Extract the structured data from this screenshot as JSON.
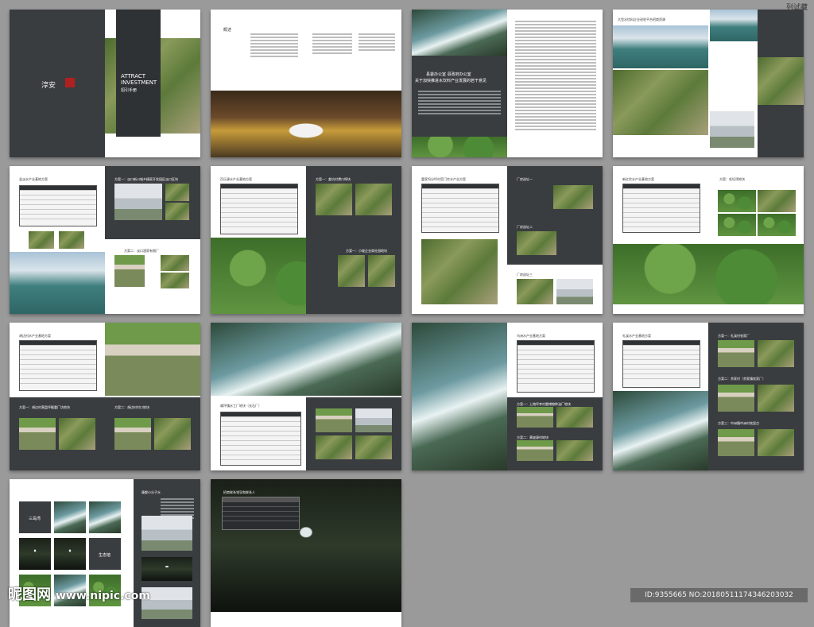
{
  "tag": "列试藏",
  "cover": {
    "seal": "淳安",
    "title_line1": "ATTRACT",
    "title_line2": "INVESTMENT",
    "subtitle": "招引手册"
  },
  "spread2": {
    "heading": "概述"
  },
  "spread3": {
    "title_line1": "县委办公室  县政府办公室",
    "title_line2": "关于加快推进水饮料产业发展的若干意见"
  },
  "spread4": {
    "heading": "大型水饮料企业进驻平台招商资源"
  },
  "spread5": {
    "left_title": "县淡水产业基地方案",
    "right_title_a": "方案一：淡口新川城乡精家开发园区淡口区块",
    "right_title_b": "方案二：淡口酒家有限厂"
  },
  "spread6": {
    "left_title": "百乐源水产业基地方案",
    "right_title_a": "方案一：姜坑村潭口埠块",
    "right_title_b": "方案一：小坡企业商社园地块"
  },
  "spread7": {
    "left_title": "富家坞分坪村官门饮水产业方案",
    "right_title_a": "厂房选址一",
    "right_title_b": "厂房选址二",
    "right_title_c": "厂房选址三"
  },
  "spread8": {
    "left_title": "新红饮水产业基地方案",
    "right_title_a": "方案：毛坦湾地块"
  },
  "spread9": {
    "left_title": "胡边村水产业基地方案",
    "bottom_a": "方案一：胡边村营盘坪畈重厂坊地块",
    "bottom_b": "方案二：胡边村村口地块"
  },
  "spread10": {
    "right_title": "威坪镇水工厂地块（长石厂）"
  },
  "spread12": {
    "right_title": "乌洲水产业基地方案",
    "item_a": "方案一：上炮坪李村雷博物种油厂地块",
    "item_b": "方案二：黄坡源村地块"
  },
  "spread13": {
    "left_title": "礼溪水产业基地方案",
    "item_a": "方案一：礼溪村农家厂",
    "item_b": "方案二：余家村（余家镇农家厂）",
    "item_c": "方案三：中洲镇中洲村农居点"
  },
  "spread14": {
    "label_a": "三岛湾",
    "label_b": "生态馆",
    "heading": "康都小分子水"
  },
  "spread15": {
    "heading": "招商联系领导和联系人"
  },
  "watermark": {
    "brand": "昵图网",
    "url": "www.nipic.com",
    "id_text": "ID:9355665 NO:20180511174346203032"
  }
}
